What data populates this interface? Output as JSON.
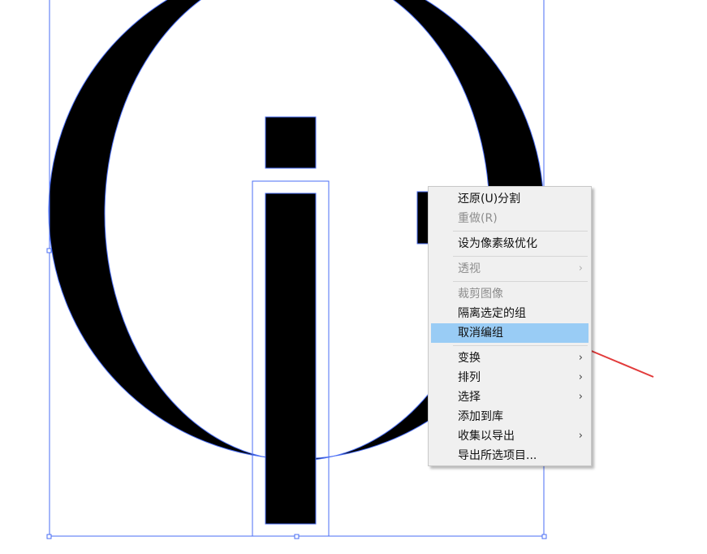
{
  "canvas": {
    "background": "#ffffff",
    "shape_fill": "#000000",
    "selection_color": "#4a6ef5",
    "annotation_color": "#e23b3b"
  },
  "context_menu": {
    "highlight_color": "#99ccf5",
    "items": [
      {
        "label": "还原(U)分割",
        "state": "enabled",
        "submenu": false
      },
      {
        "label": "重做(R)",
        "state": "disabled",
        "submenu": false
      },
      {
        "type": "separator"
      },
      {
        "label": "设为像素级优化",
        "state": "enabled",
        "submenu": false
      },
      {
        "type": "separator"
      },
      {
        "label": "透视",
        "state": "disabled",
        "submenu": true
      },
      {
        "type": "separator"
      },
      {
        "label": "裁剪图像",
        "state": "disabled",
        "submenu": false
      },
      {
        "label": "隔离选定的组",
        "state": "enabled",
        "submenu": false
      },
      {
        "label": "取消编组",
        "state": "highlighted",
        "submenu": false
      },
      {
        "type": "separator"
      },
      {
        "label": "变换",
        "state": "enabled",
        "submenu": true
      },
      {
        "label": "排列",
        "state": "enabled",
        "submenu": true
      },
      {
        "label": "选择",
        "state": "enabled",
        "submenu": true
      },
      {
        "label": "添加到库",
        "state": "enabled",
        "submenu": false
      },
      {
        "label": "收集以导出",
        "state": "enabled",
        "submenu": true
      },
      {
        "label": "导出所选项目...",
        "state": "enabled",
        "submenu": false
      }
    ]
  },
  "annotation": {
    "icon": "red-arrow-pointing-left"
  }
}
